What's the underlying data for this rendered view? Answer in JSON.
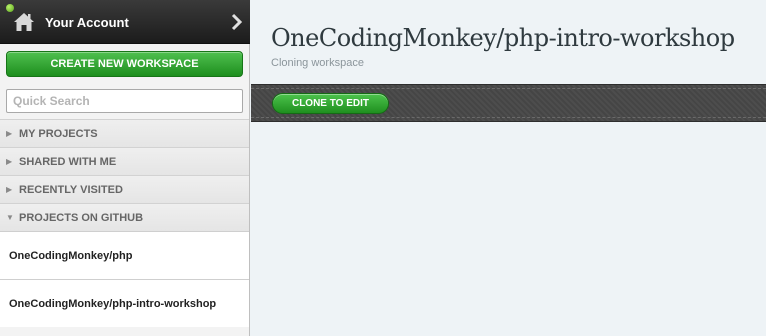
{
  "sidebar": {
    "account_label": "Your Account",
    "home_icon": "home-icon",
    "chevron_icon": "chevron-right-icon",
    "create_button": "CREATE NEW WORKSPACE",
    "search_placeholder": "Quick Search",
    "sections": [
      {
        "label": "MY PROJECTS",
        "expanded": false
      },
      {
        "label": "SHARED WITH ME",
        "expanded": false
      },
      {
        "label": "RECENTLY VISITED",
        "expanded": false
      },
      {
        "label": "PROJECTS ON GITHUB",
        "expanded": true
      }
    ],
    "projects": [
      {
        "name": "OneCodingMonkey/php"
      },
      {
        "name": "OneCodingMonkey/php-intro-workshop"
      }
    ]
  },
  "main": {
    "title": "OneCodingMonkey/php-intro-workshop",
    "subtitle": "Cloning workspace",
    "clone_button": "CLONE TO EDIT"
  },
  "colors": {
    "accent_green": "#2ea52e",
    "dark_bar": "#474747",
    "background": "#eef3f6"
  }
}
